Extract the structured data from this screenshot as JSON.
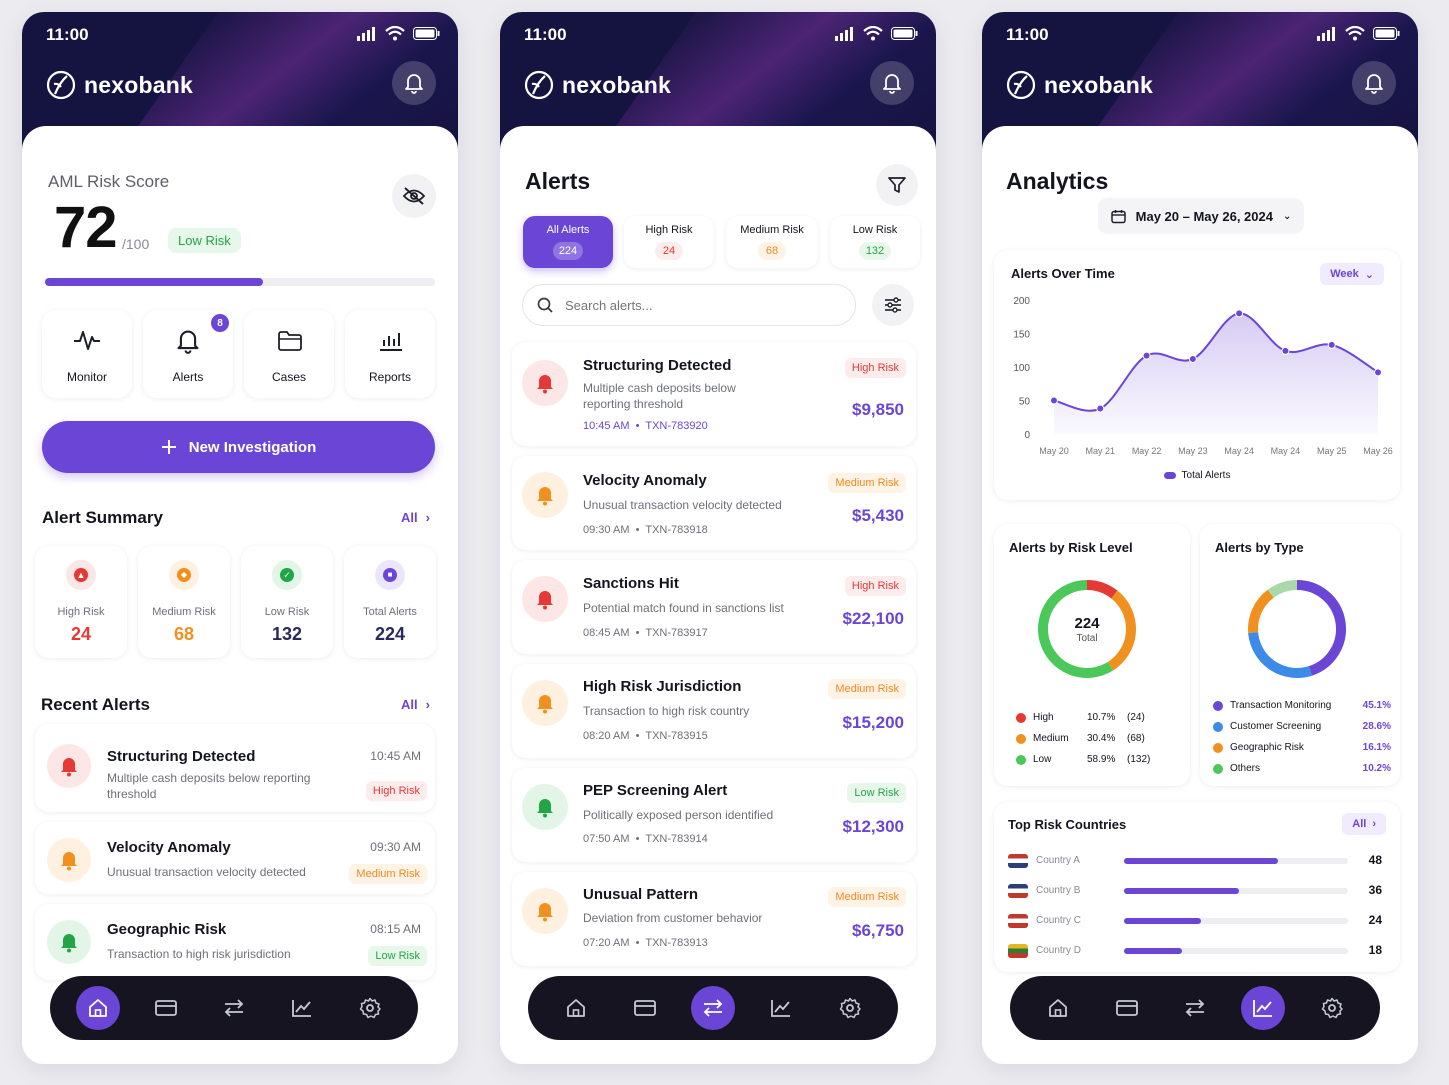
{
  "status_time": "11:00",
  "brand": "nexobank",
  "colors": {
    "header_bg": "#15133f",
    "accent": "#6b46d6",
    "high": "#e53935",
    "medium": "#f08a1c",
    "low": "#22a645",
    "total": "#6b46d6"
  },
  "home": {
    "aml_label": "AML Risk Score",
    "score": "72",
    "score_max": "/100",
    "score_fraction": 0.56,
    "risk_badge": "Low Risk",
    "quick": [
      {
        "label": "Monitor",
        "icon": "pulse-icon"
      },
      {
        "label": "Alerts",
        "icon": "bell-icon",
        "badge": "8"
      },
      {
        "label": "Cases",
        "icon": "folder-icon"
      },
      {
        "label": "Reports",
        "icon": "bar-chart-icon"
      }
    ],
    "new_investigation": "New Investigation",
    "alert_summary_title": "Alert Summary",
    "all_link": "All",
    "summary": [
      {
        "label": "High Risk",
        "value": "24"
      },
      {
        "label": "Medium Risk",
        "value": "68"
      },
      {
        "label": "Low Risk",
        "value": "132"
      },
      {
        "label": "Total Alerts",
        "value": "224"
      }
    ],
    "recent_title": "Recent Alerts",
    "recent": [
      {
        "title": "Structuring Detected",
        "desc": "Multiple cash deposits below reporting threshold",
        "time": "10:45 AM",
        "risk": "High Risk"
      },
      {
        "title": "Velocity Anomaly",
        "desc": "Unusual transaction velocity detected",
        "time": "09:30 AM",
        "risk": "Medium Risk"
      },
      {
        "title": "Geographic Risk",
        "desc": "Transaction to high risk jurisdiction",
        "time": "08:15 AM",
        "risk": "Low Risk"
      }
    ]
  },
  "alerts": {
    "title": "Alerts",
    "tabs": [
      {
        "label": "All Alerts",
        "count": "224"
      },
      {
        "label": "High Risk",
        "count": "24"
      },
      {
        "label": "Medium Risk",
        "count": "68"
      },
      {
        "label": "Low Risk",
        "count": "132"
      }
    ],
    "search_placeholder": "Search alerts...",
    "items": [
      {
        "title": "Structuring Detected",
        "desc": "Multiple cash deposits below reporting threshold",
        "time": "10:45 AM",
        "txn": "TXN-783920",
        "risk": "High Risk",
        "amount": "$9,850"
      },
      {
        "title": "Velocity Anomaly",
        "desc": "Unusual transaction velocity detected",
        "time": "09:30 AM",
        "txn": "TXN-783918",
        "risk": "Medium Risk",
        "amount": "$5,430"
      },
      {
        "title": "Sanctions Hit",
        "desc": "Potential match found in sanctions list",
        "time": "08:45 AM",
        "txn": "TXN-783917",
        "risk": "High Risk",
        "amount": "$22,100"
      },
      {
        "title": "High Risk Jurisdiction",
        "desc": "Transaction to high risk country",
        "time": "08:20 AM",
        "txn": "TXN-783915",
        "risk": "Medium Risk",
        "amount": "$15,200"
      },
      {
        "title": "PEP Screening Alert",
        "desc": "Politically exposed person identified",
        "time": "07:50 AM",
        "txn": "TXN-783914",
        "risk": "Low Risk",
        "amount": "$12,300"
      },
      {
        "title": "Unusual Pattern",
        "desc": "Deviation from customer behavior",
        "time": "07:20 AM",
        "txn": "TXN-783913",
        "risk": "Medium Risk",
        "amount": "$6,750"
      }
    ]
  },
  "analytics": {
    "title": "Analytics",
    "date_range": "May 20 – May 26, 2024",
    "alerts_over_time_title": "Alerts Over Time",
    "period": "Week",
    "legend_total": "Total Alerts",
    "by_risk_title": "Alerts by Risk Level",
    "by_type_title": "Alerts by Type",
    "donut_center_value": "224",
    "donut_center_label": "Total",
    "risk_rows": [
      {
        "label": "High",
        "pct": "10.7%",
        "count": "(24)"
      },
      {
        "label": "Medium",
        "pct": "30.4%",
        "count": "(68)"
      },
      {
        "label": "Low",
        "pct": "58.9%",
        "count": "(132)"
      }
    ],
    "type_rows": [
      {
        "label": "Transaction Monitoring",
        "pct": "45.1%"
      },
      {
        "label": "Customer Screening",
        "pct": "28.6%"
      },
      {
        "label": "Geographic Risk",
        "pct": "16.1%"
      },
      {
        "label": "Others",
        "pct": "10.2%"
      }
    ],
    "top_countries_title": "Top Risk Countries",
    "countries": [
      {
        "label": "Country A",
        "value": "48"
      },
      {
        "label": "Country B",
        "value": "36"
      },
      {
        "label": "Country C",
        "value": "24"
      },
      {
        "label": "Country D",
        "value": "18"
      }
    ]
  },
  "chart_data": [
    {
      "type": "area",
      "title": "Alerts Over Time",
      "categories": [
        "May 20",
        "May 21",
        "May 22",
        "May 23",
        "May 24",
        "May 24",
        "May 25",
        "May 26"
      ],
      "x": [
        "May 20",
        "May 21",
        "May 22",
        "May 23",
        "May 24",
        "May 24",
        "May 25",
        "May 26"
      ],
      "series": [
        {
          "name": "Total Alerts",
          "values": [
            50,
            38,
            117,
            112,
            180,
            124,
            133,
            92
          ]
        }
      ],
      "yticks": [
        "200",
        "150",
        "100",
        "50",
        "0"
      ],
      "ylim": [
        0,
        200
      ],
      "grid": false,
      "legend": "bottom"
    },
    {
      "type": "pie",
      "title": "Alerts by Risk Level",
      "categories": [
        "High",
        "Medium",
        "Low"
      ],
      "values": [
        10.7,
        30.4,
        58.9
      ],
      "colors": [
        "#e53935",
        "#f0901f",
        "#4cc75a"
      ]
    },
    {
      "type": "pie",
      "title": "Alerts by Type",
      "categories": [
        "Transaction Monitoring",
        "Customer Screening",
        "Geographic Risk",
        "Others"
      ],
      "values": [
        45.1,
        28.6,
        16.1,
        10.2
      ],
      "colors": [
        "#6b46d6",
        "#3d8be8",
        "#f0901f",
        "#a9d9a9"
      ]
    },
    {
      "type": "bar",
      "title": "Top Risk Countries",
      "categories": [
        "Country A",
        "Country B",
        "Country C",
        "Country D"
      ],
      "values": [
        48,
        36,
        24,
        18
      ],
      "xlim": [
        0,
        70
      ]
    }
  ]
}
